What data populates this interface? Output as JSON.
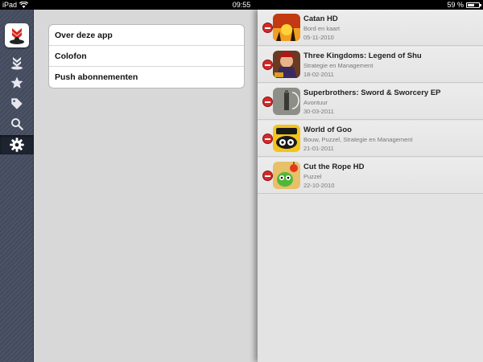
{
  "status_bar": {
    "device": "iPad",
    "time": "09:55",
    "battery": "59 %",
    "battery_level": 0.59
  },
  "sidebar": {
    "logo_icon": "red-hat-logo-icon",
    "items": [
      {
        "icon": "chevrons-down-icon"
      },
      {
        "icon": "star-icon"
      },
      {
        "icon": "tag-icon"
      },
      {
        "icon": "search-icon"
      },
      {
        "icon": "gear-icon",
        "active": true
      }
    ]
  },
  "settings_menu": {
    "items": [
      {
        "label": "Over deze app"
      },
      {
        "label": "Colofon"
      },
      {
        "label": "Push abonnementen"
      }
    ]
  },
  "games": [
    {
      "title": "Catan HD",
      "category": "Bord en kaart",
      "date": "05-11-2010",
      "icon": "catan-hd-icon"
    },
    {
      "title": "Three Kingdoms: Legend of Shu",
      "category": "Strategie en Management",
      "date": "18-02-2011",
      "icon": "three-kingdoms-icon"
    },
    {
      "title": "Superbrothers: Sword & Sworcery EP",
      "category": "Avontuur",
      "date": "30-03-2011",
      "icon": "sworcery-icon"
    },
    {
      "title": "World of Goo",
      "category": "Bouw, Puzzel, Strategie en Management",
      "date": "21-01-2011",
      "icon": "world-of-goo-icon"
    },
    {
      "title": "Cut the Rope HD",
      "category": "Puzzel",
      "date": "22-10-2010",
      "icon": "cut-the-rope-icon"
    }
  ],
  "colors": {
    "sidebar": "#4b5366",
    "delete": "#d42a2a",
    "middle_bg": "#d8d8d8",
    "right_bg": "#e3e3e3"
  }
}
